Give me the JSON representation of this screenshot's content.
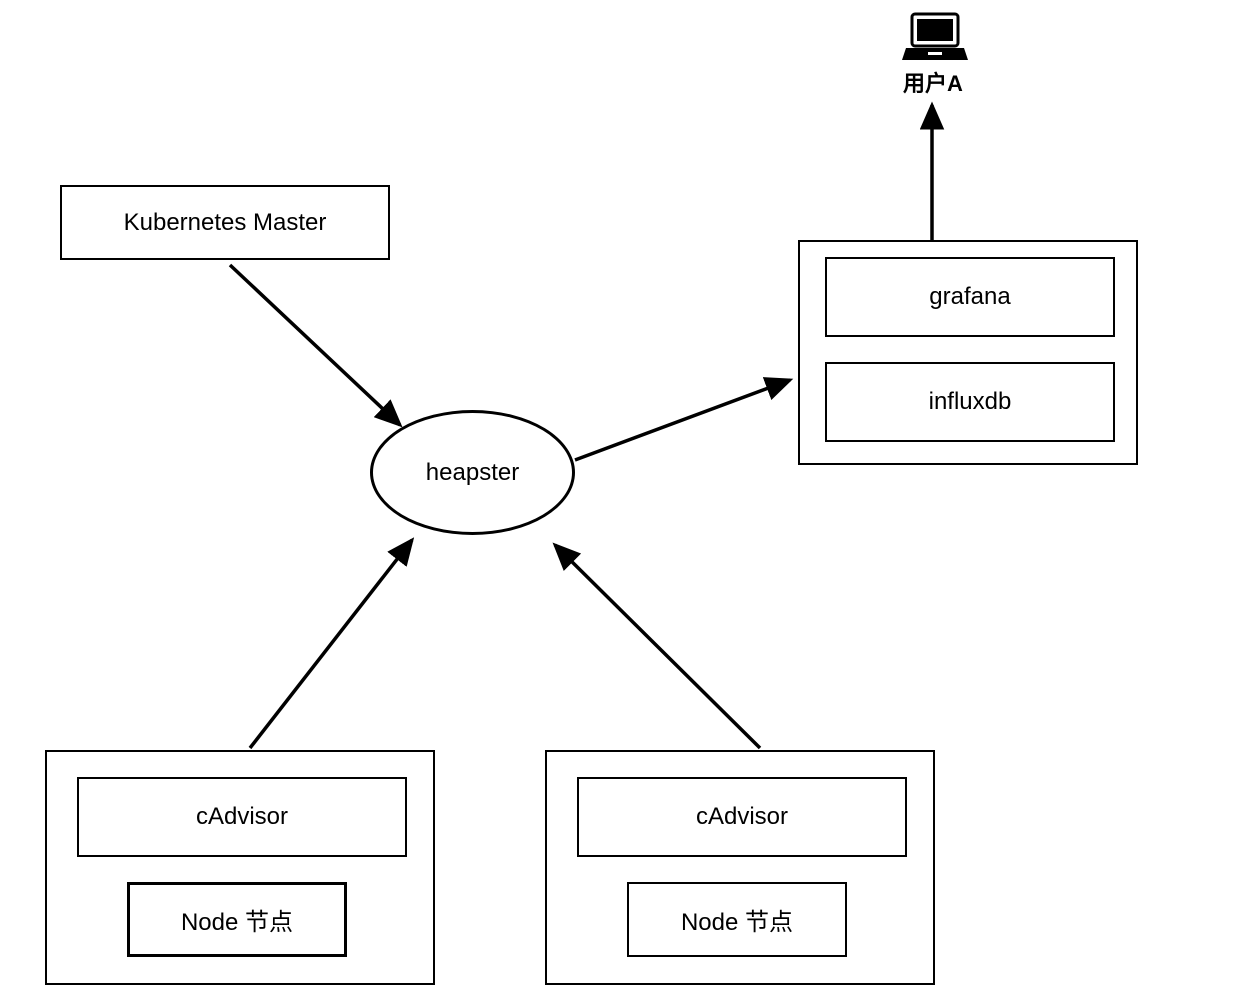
{
  "user": {
    "label": "用户A"
  },
  "master": {
    "label": "Kubernetes Master"
  },
  "heapster": {
    "label": "heapster"
  },
  "storage": {
    "grafana": "grafana",
    "influxdb": "influxdb"
  },
  "node1": {
    "cadvisor": "cAdvisor",
    "node": "Node 节点"
  },
  "node2": {
    "cadvisor": "cAdvisor",
    "node": "Node 节点"
  }
}
